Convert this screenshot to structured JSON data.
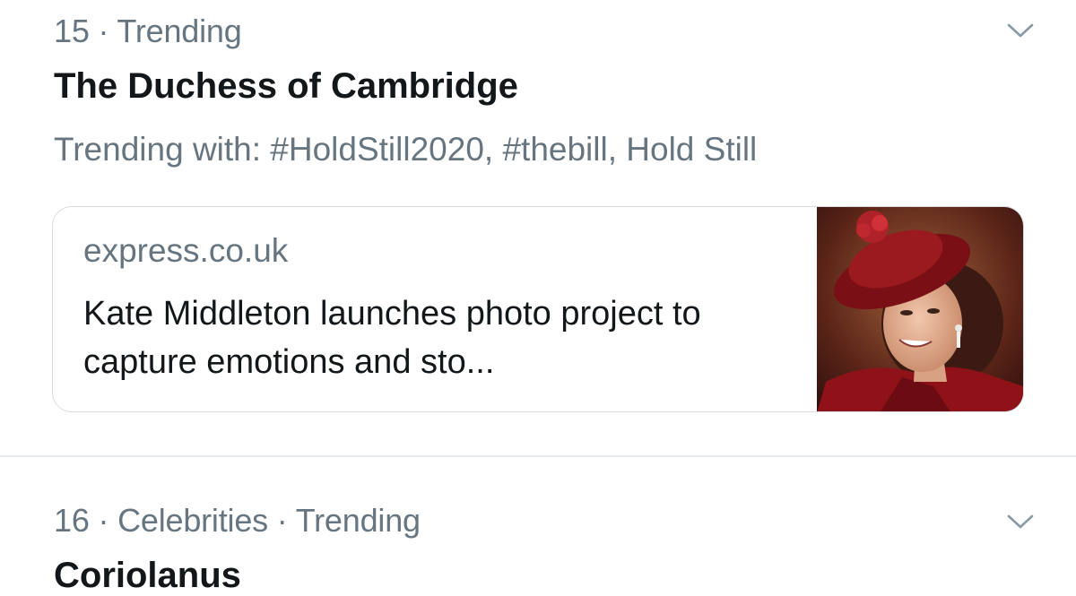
{
  "trends": [
    {
      "rank": "15",
      "separator": "·",
      "context": "Trending",
      "title": "The Duchess of Cambridge",
      "trending_with": "Trending with: #HoldStill2020, #thebill, Hold Still",
      "card": {
        "domain": "express.co.uk",
        "headline": "Kate Middleton launches photo project to capture emotions and sto..."
      }
    },
    {
      "rank": "16",
      "separator": "·",
      "context": "Celebrities · Trending",
      "title": "Coriolanus"
    }
  ],
  "icons": {
    "more": "chevron-down-icon"
  },
  "colors": {
    "secondary_text": "#66757f",
    "primary_text": "#14171a",
    "border": "#d7dde2",
    "divider": "#e6ecf0"
  }
}
